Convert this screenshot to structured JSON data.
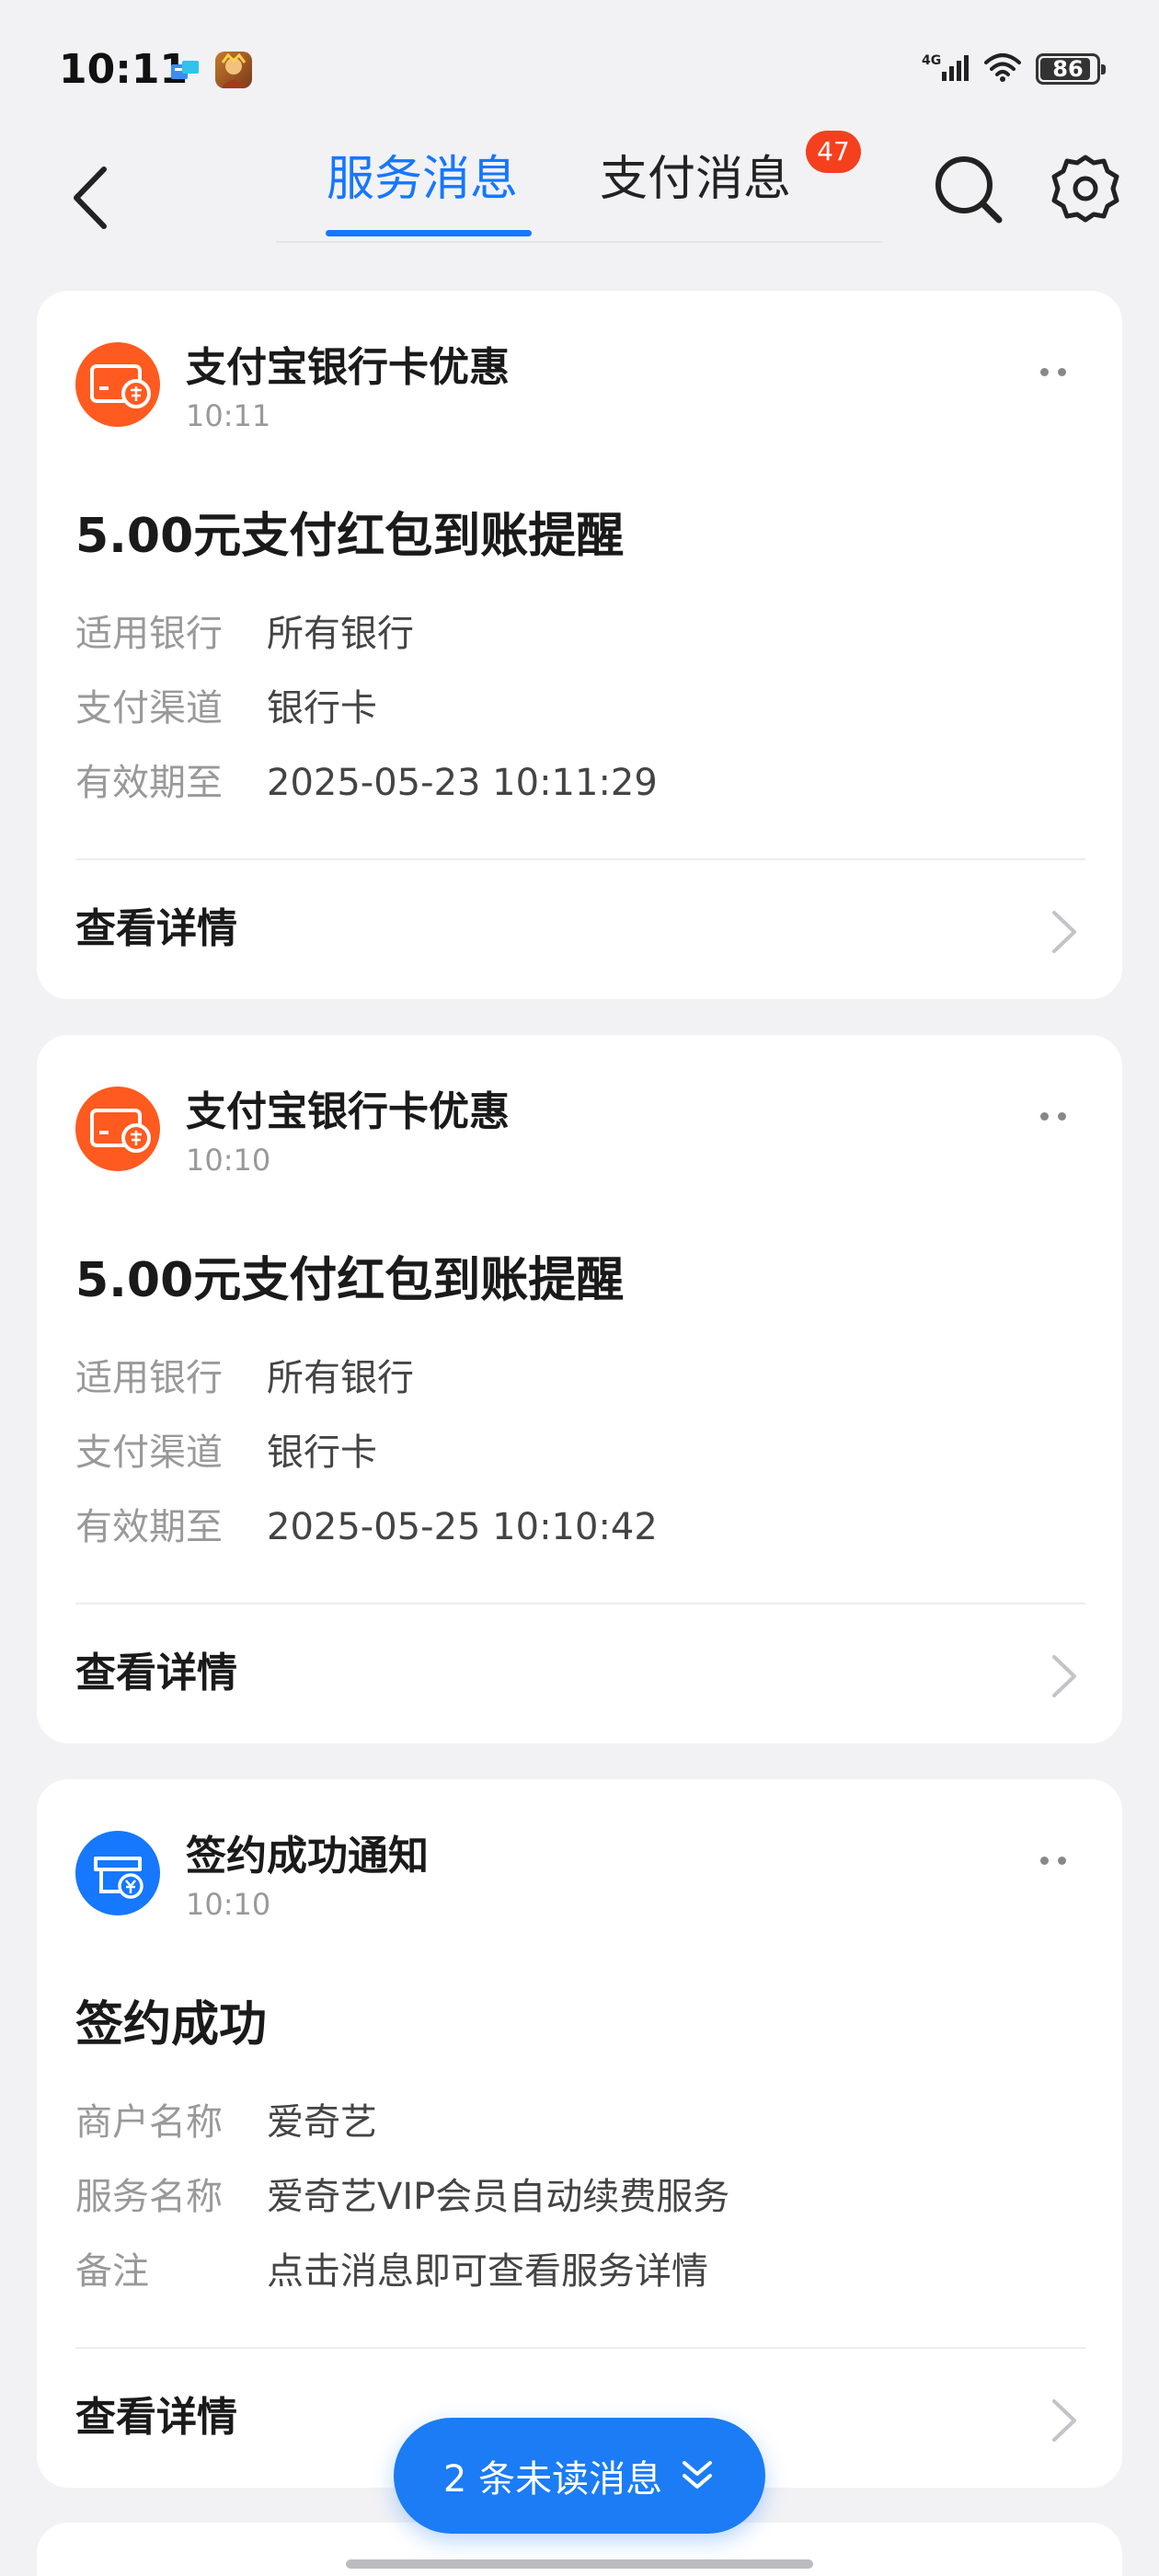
{
  "status_bar": {
    "time": "10:11",
    "network": "4G",
    "battery": "86",
    "icons": [
      "notification-app-icon",
      "game-app-icon",
      "signal-icon",
      "wifi-icon",
      "battery-icon"
    ]
  },
  "nav": {
    "tabs": [
      {
        "label": "服务消息",
        "active": true
      },
      {
        "label": "支付消息",
        "active": false,
        "badge": "47"
      }
    ],
    "icons": [
      "back-icon",
      "search-icon",
      "settings-icon"
    ]
  },
  "cards": [
    {
      "source": "支付宝银行卡优惠",
      "time": "10:11",
      "icon": "bank-card-discount-icon",
      "title": "5.00元支付红包到账提醒",
      "rows": [
        {
          "key": "适用银行",
          "value": "所有银行"
        },
        {
          "key": "支付渠道",
          "value": "银行卡"
        },
        {
          "key": "有效期至",
          "value": "2025-05-23 10:11:29"
        }
      ],
      "detail": "查看详情"
    },
    {
      "source": "支付宝银行卡优惠",
      "time": "10:10",
      "icon": "bank-card-discount-icon",
      "title": "5.00元支付红包到账提醒",
      "rows": [
        {
          "key": "适用银行",
          "value": "所有银行"
        },
        {
          "key": "支付渠道",
          "value": "银行卡"
        },
        {
          "key": "有效期至",
          "value": "2025-05-25 10:10:42"
        }
      ],
      "detail": "查看详情"
    },
    {
      "source": "签约成功通知",
      "time": "10:10",
      "icon": "contract-icon",
      "title": "签约成功",
      "rows": [
        {
          "key": "商户名称",
          "value": "爱奇艺"
        },
        {
          "key": "服务名称",
          "value": "爱奇艺VIP会员自动续费服务"
        },
        {
          "key": "备注",
          "value": "点击消息即可查看服务详情"
        }
      ],
      "detail": "查看详情"
    }
  ],
  "unread": {
    "count": "2",
    "label": "条未读消息",
    "icon": "double-chevron-down-icon"
  },
  "colors": {
    "accent": "#1677ff",
    "badge": "#f5401e",
    "promo_icon": "#ff5a1f",
    "background": "#f2f2f5"
  }
}
